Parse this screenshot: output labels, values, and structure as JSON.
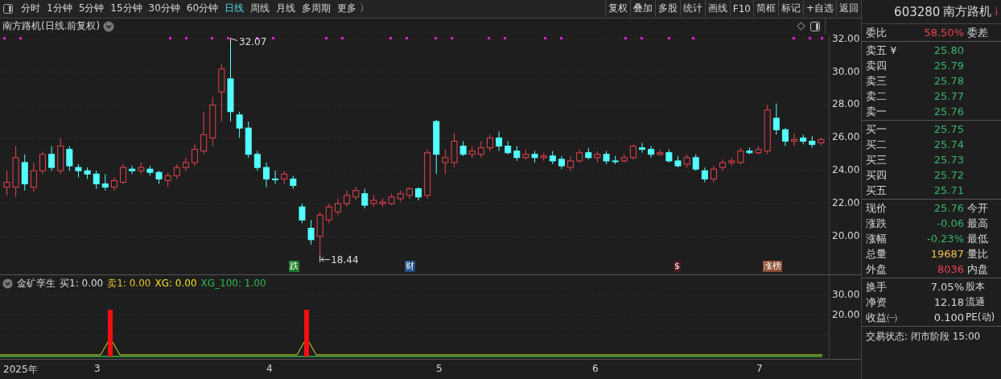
{
  "toolbar": {
    "periods": [
      {
        "label": "分时",
        "selected": false
      },
      {
        "label": "1分钟",
        "selected": false
      },
      {
        "label": "5分钟",
        "selected": false
      },
      {
        "label": "15分钟",
        "selected": false
      },
      {
        "label": "30分钟",
        "selected": false
      },
      {
        "label": "60分钟",
        "selected": false
      },
      {
        "label": "日线",
        "selected": true
      },
      {
        "label": "周线",
        "selected": false
      },
      {
        "label": "月线",
        "selected": false
      },
      {
        "label": "多周期",
        "selected": false
      },
      {
        "label": "更多 〉",
        "selected": false
      }
    ],
    "actions": [
      "复权",
      "叠加",
      "多股",
      "统计",
      "画线",
      "F10",
      "简框",
      "标记",
      "+自选",
      "返回"
    ]
  },
  "chart": {
    "title": "南方路机(日线.前复权)",
    "y_labels": [
      "32.00",
      "30.00",
      "28.00",
      "26.00",
      "24.00",
      "22.00",
      "20.00"
    ],
    "high_label": "32.07",
    "low_label": "18.44",
    "event_markers": [
      {
        "label": "跌",
        "color": "#1e7a2c"
      },
      {
        "label": "财",
        "color": "#1f4f86"
      },
      {
        "label": "$",
        "color": "#4a1c1c"
      },
      {
        "label": "涨榜",
        "color": "#8a4b2e"
      }
    ]
  },
  "indicator": {
    "name": "金矿孪生",
    "values": [
      {
        "label": "买1: 0.00",
        "color": "#dddddd"
      },
      {
        "label": "卖1: 0.00",
        "color": "#e8c02e"
      },
      {
        "label": "XG: 0.00",
        "color": "#f0e020"
      },
      {
        "label": "XG_100: 1.00",
        "color": "#2fb84a"
      }
    ],
    "y_labels": [
      "30.00",
      "20.00"
    ]
  },
  "date_axis": [
    "2025年",
    "3",
    "4",
    "5",
    "6",
    "7"
  ],
  "quote": {
    "code": "603280",
    "name": "南方路机",
    "info": "i"
  },
  "order_book": {
    "ratio": {
      "label": "委比",
      "value": "58.50%",
      "extra": "委差"
    },
    "asks": [
      {
        "label": "卖五 ¥",
        "price": "25.80"
      },
      {
        "label": "卖四",
        "price": "25.79"
      },
      {
        "label": "卖三",
        "price": "25.78"
      },
      {
        "label": "卖二",
        "price": "25.77"
      },
      {
        "label": "卖一",
        "price": "25.76"
      }
    ],
    "bids": [
      {
        "label": "买一",
        "price": "25.75"
      },
      {
        "label": "买二",
        "price": "25.74"
      },
      {
        "label": "买三",
        "price": "25.73"
      },
      {
        "label": "买四",
        "price": "25.72"
      },
      {
        "label": "买五",
        "price": "25.71"
      }
    ]
  },
  "stats": [
    {
      "label": "现价",
      "value": "25.76",
      "color": "#3bb36a",
      "extra": "今开"
    },
    {
      "label": "涨跌",
      "value": "-0.06",
      "color": "#3bb36a",
      "extra": "最高"
    },
    {
      "label": "涨幅",
      "value": "-0.23%",
      "color": "#3bb36a",
      "extra": "最低"
    },
    {
      "label": "总量",
      "value": "19687",
      "color": "#f0c050",
      "extra": "量比"
    },
    {
      "label": "外盘",
      "value": "8036",
      "color": "#e8434f",
      "extra": "内盘"
    }
  ],
  "fundamentals": [
    {
      "label": "换手",
      "value": "7.05%",
      "extra": "股本"
    },
    {
      "label": "净资",
      "value": "12.18",
      "extra": "流通"
    },
    {
      "label": "收益㈠",
      "value": "0.100",
      "extra": "PE(动)"
    }
  ],
  "trading_status": "交易状态: 闭市阶段 15:00"
}
